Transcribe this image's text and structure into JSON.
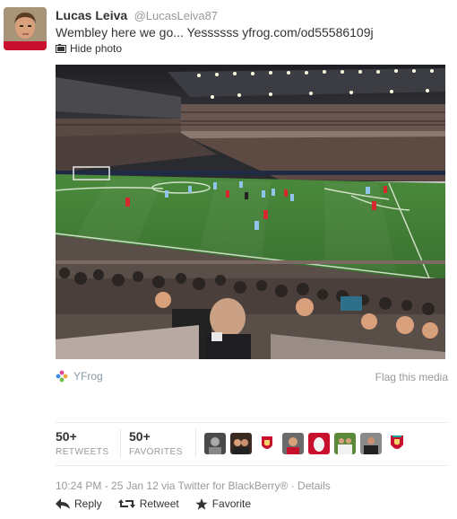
{
  "user": {
    "display_name": "Lucas Leiva",
    "handle": "@LucasLeiva87",
    "avatar_icon": "player-avatar"
  },
  "tweet": {
    "text": "Wembley here we go... Yessssss yfrog.com/od55586109j",
    "hide_photo_label": "Hide photo"
  },
  "media": {
    "provider": "YFrog",
    "flag_label": "Flag this media",
    "photo_icon": "stadium-photo"
  },
  "stats": {
    "retweets_count": "50+",
    "retweets_label": "RETWEETS",
    "favorites_count": "50+",
    "favorites_label": "FAVORITES"
  },
  "meta": {
    "line": "10:24 PM - 25 Jan 12 via Twitter for BlackBerry® · Details"
  },
  "actions": {
    "reply": "Reply",
    "retweet": "Retweet",
    "favorite": "Favorite"
  },
  "colors": {
    "pitch": "#3f7a35",
    "link_muted": "#999999",
    "name": "#333333"
  }
}
